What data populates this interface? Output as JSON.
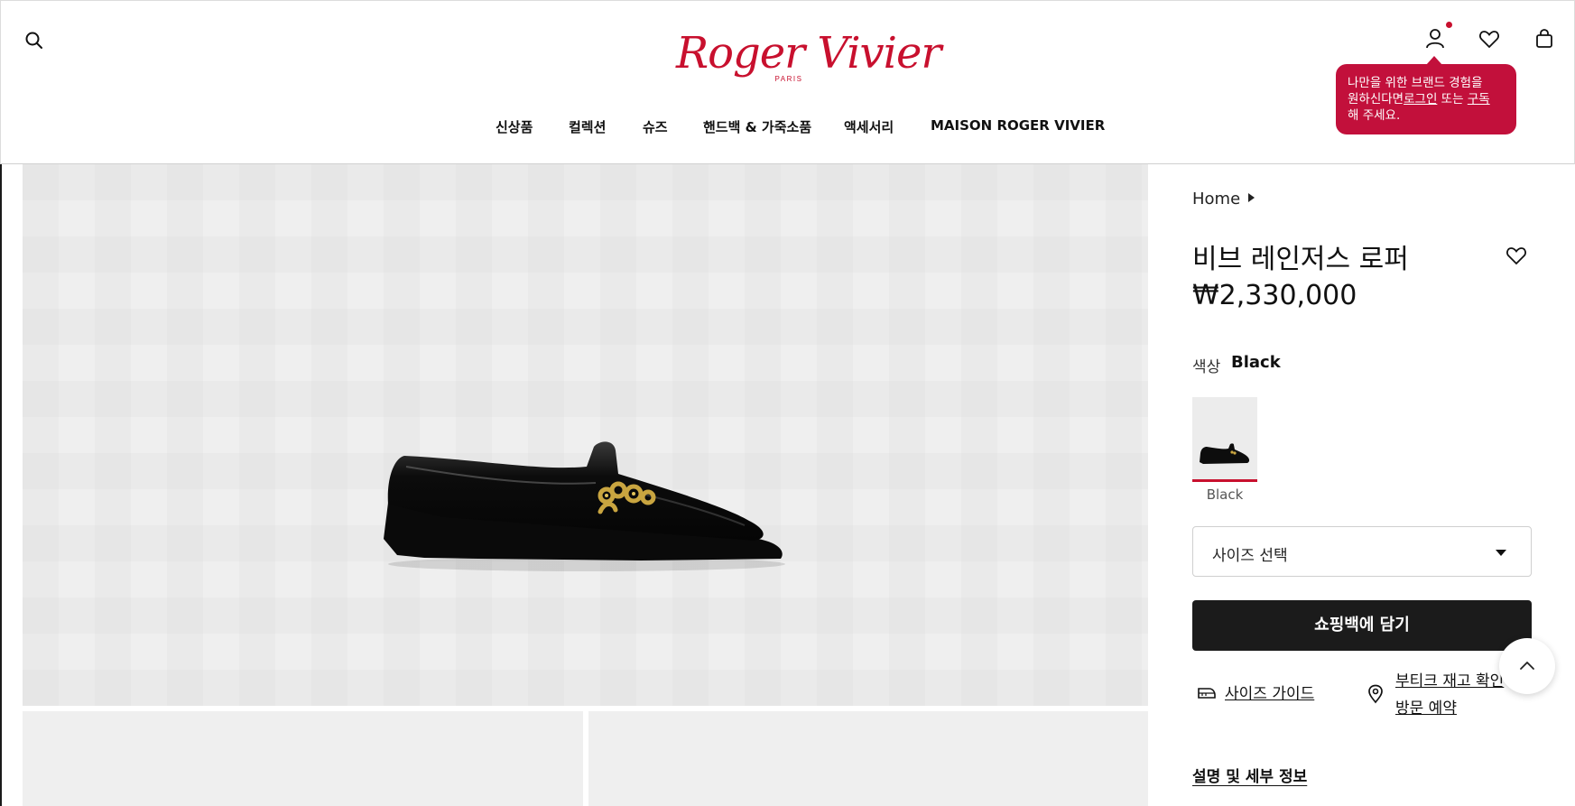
{
  "header": {
    "logo_text": "Roger Vivier",
    "logo_sub": "PARIS",
    "nav": [
      "신상품",
      "컬렉션",
      "슈즈",
      "핸드백 & 가죽소품",
      "액세서리",
      "MAISON ROGER VIVIER"
    ],
    "icons": [
      "search-icon",
      "account-icon",
      "heart-icon",
      "bag-icon"
    ]
  },
  "tooltip": {
    "line1": "나만을 위한 브랜드 경험을",
    "line2_prefix": "원하신다면",
    "login_link": "로그인",
    "line2_mid": " 또는 ",
    "subscribe_link": "구독",
    "line3": "해 주세요."
  },
  "product": {
    "breadcrumb": "Home",
    "title": "비브 레인저스 로퍼",
    "price": "₩2,330,000",
    "color_label": "색상",
    "color_value": "Black",
    "swatch_label": "Black",
    "size_placeholder": "사이즈 선택",
    "add_to_bag": "쇼핑백에 담기",
    "size_guide": "사이즈 가이드",
    "boutique_line1": "부티크 재고 확인",
    "boutique_line2": "방문 예약",
    "details_tab": "설명 및 세부 정보"
  },
  "colors": {
    "brand_red": "#c8102e",
    "tooltip_bg": "#c2103b",
    "button_dark": "#1b1b1b",
    "photo_bg": "#efefef"
  }
}
